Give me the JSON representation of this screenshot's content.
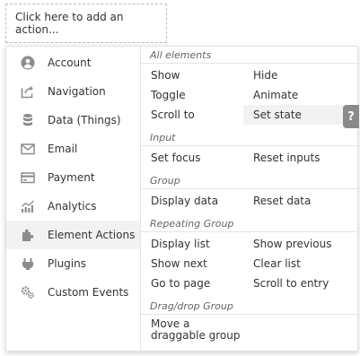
{
  "trigger": {
    "label": "Click here to add an action..."
  },
  "categories": [
    {
      "label": "Account",
      "icon": "account-icon"
    },
    {
      "label": "Navigation",
      "icon": "navigation-icon"
    },
    {
      "label": "Data (Things)",
      "icon": "database-icon"
    },
    {
      "label": "Email",
      "icon": "email-icon"
    },
    {
      "label": "Payment",
      "icon": "payment-icon"
    },
    {
      "label": "Analytics",
      "icon": "analytics-icon"
    },
    {
      "label": "Element Actions",
      "icon": "puzzle-icon",
      "active": true
    },
    {
      "label": "Plugins",
      "icon": "plugin-icon"
    },
    {
      "label": "Custom Events",
      "icon": "gears-icon"
    }
  ],
  "sections": [
    {
      "title": "All elements",
      "items": [
        "Show",
        "Hide",
        "Toggle",
        "Animate",
        "Scroll to",
        "Set state"
      ]
    },
    {
      "title": "Input",
      "items": [
        "Set focus",
        "Reset inputs"
      ]
    },
    {
      "title": "Group",
      "items": [
        "Display data",
        "Reset data"
      ]
    },
    {
      "title": "Repeating Group",
      "items": [
        "Display list",
        "Show previous",
        "Show next",
        "Clear list",
        "Go to page",
        "Scroll to entry"
      ]
    },
    {
      "title": "Drag/drop Group",
      "items": [
        "Move a draggable group"
      ]
    }
  ],
  "help": {
    "label": "?"
  },
  "colors": {
    "active_bg": "#f2f2f2",
    "icon": "#8c8c8c",
    "help_bg": "#8a8a8a"
  }
}
